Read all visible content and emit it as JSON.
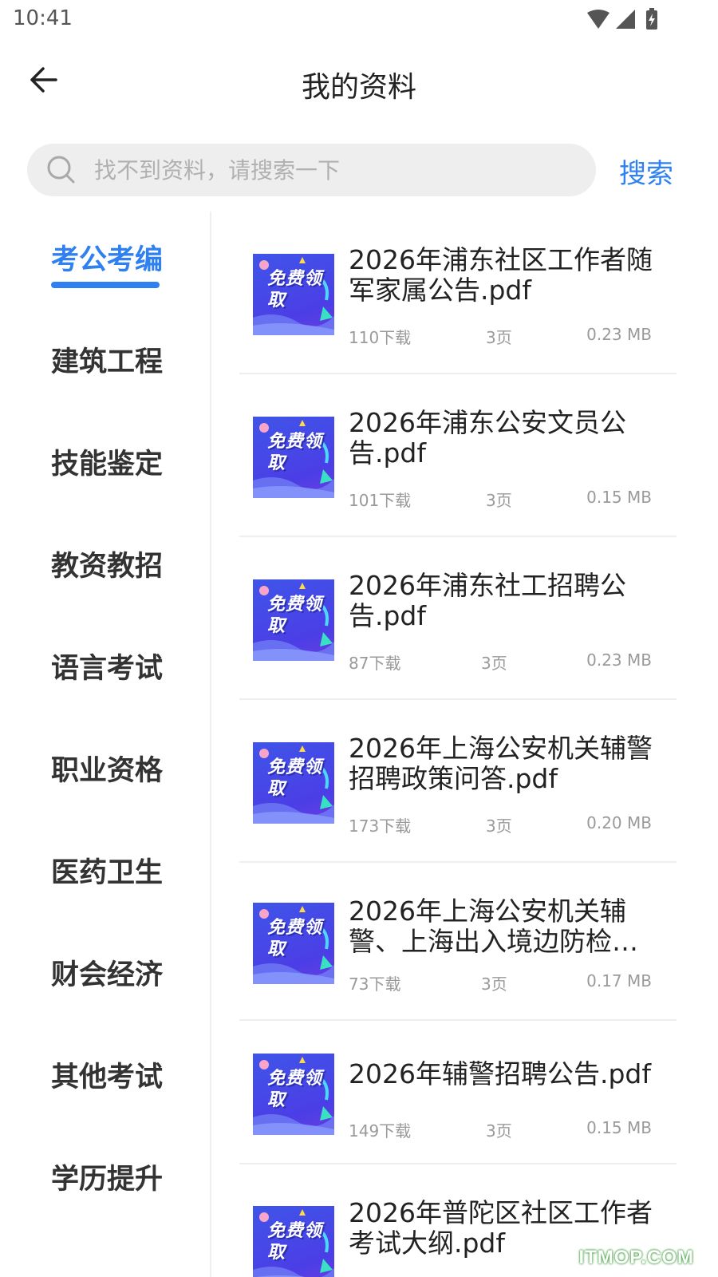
{
  "status_bar": {
    "time": "10:41"
  },
  "header": {
    "title": "我的资料"
  },
  "search": {
    "placeholder": "找不到资料，请搜索一下",
    "value": "",
    "button_label": "搜索"
  },
  "sidebar": {
    "active_index": 0,
    "items": [
      {
        "label": "考公考编"
      },
      {
        "label": "建筑工程"
      },
      {
        "label": "技能鉴定"
      },
      {
        "label": "教资教招"
      },
      {
        "label": "语言考试"
      },
      {
        "label": "职业资格"
      },
      {
        "label": "医药卫生"
      },
      {
        "label": "财会经济"
      },
      {
        "label": "其他考试"
      },
      {
        "label": "学历提升"
      }
    ]
  },
  "thumbnail_text": "免费领取",
  "documents": [
    {
      "title": "2026年浦东社区工作者随军家属公告.pdf",
      "downloads": "110下载",
      "pages": "3页",
      "size": "0.23 MB"
    },
    {
      "title": "2026年浦东公安文员公告.pdf",
      "downloads": "101下载",
      "pages": "3页",
      "size": "0.15 MB"
    },
    {
      "title": "2026年浦东社工招聘公告.pdf",
      "downloads": "87下载",
      "pages": "3页",
      "size": "0.23 MB"
    },
    {
      "title": "2026年上海公安机关辅警招聘政策问答.pdf",
      "downloads": "173下载",
      "pages": "3页",
      "size": "0.20 MB"
    },
    {
      "title": "2026年上海公安机关辅警、上海出入境边防检…",
      "downloads": "73下载",
      "pages": "3页",
      "size": "0.17 MB"
    },
    {
      "title": "2026年辅警招聘公告.pdf",
      "downloads": "149下载",
      "pages": "3页",
      "size": "0.15 MB"
    },
    {
      "title": "2026年普陀区社区工作者考试大纲.pdf",
      "downloads": "",
      "pages": "",
      "size": ""
    }
  ],
  "watermark": "ITMOP.COM",
  "colors": {
    "accent": "#2f80f0",
    "thumb_bg": "#4b3ee6"
  }
}
